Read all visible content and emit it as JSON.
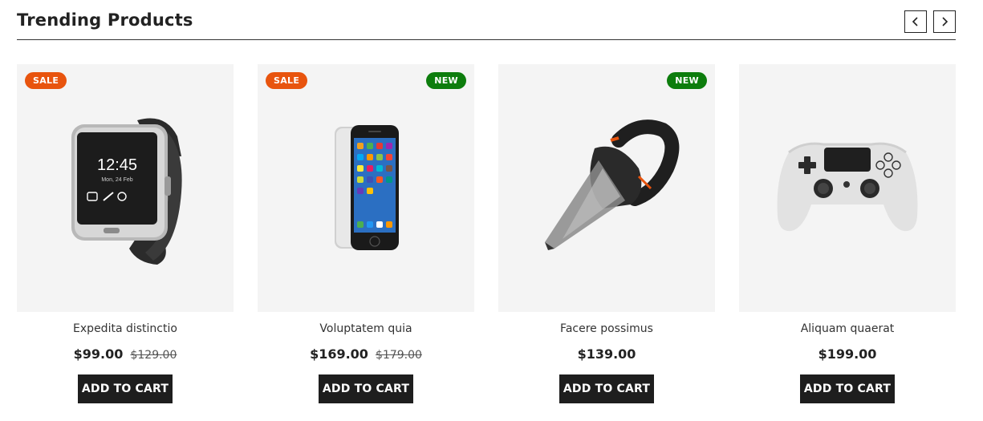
{
  "section": {
    "title": "Trending Products"
  },
  "products": [
    {
      "name": "Expedita distinctio",
      "price": "$99.00",
      "old_price": "$129.00",
      "badges": [
        "SALE"
      ],
      "cta": "ADD TO CART",
      "image": "smartwatch"
    },
    {
      "name": "Voluptatem quia",
      "price": "$169.00",
      "old_price": "$179.00",
      "badges": [
        "SALE",
        "NEW"
      ],
      "cta": "ADD TO CART",
      "image": "smartphone"
    },
    {
      "name": "Facere possimus",
      "price": "$139.00",
      "badges": [
        "NEW"
      ],
      "cta": "ADD TO CART",
      "image": "handheld-vacuum"
    },
    {
      "name": "Aliquam quaerat",
      "price": "$199.00",
      "badges": [],
      "cta": "ADD TO CART",
      "image": "game-controller"
    }
  ],
  "colors": {
    "sale_badge": "#e8540e",
    "new_badge": "#0d7d0d",
    "button": "#1e1e1e",
    "card_bg": "#f4f4f4"
  }
}
